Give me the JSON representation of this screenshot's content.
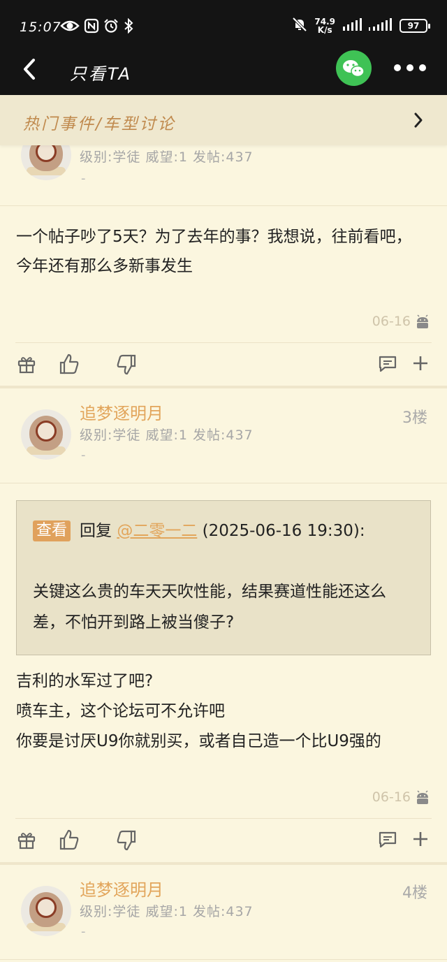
{
  "status": {
    "time": "15:07",
    "speed_value": "74.9",
    "speed_unit": "K/s",
    "battery": "97"
  },
  "nav": {
    "title": "只看TA"
  },
  "category": {
    "label": "热门事件/车型讨论"
  },
  "posts": [
    {
      "level_text": "级别:学徒 威望:1 发帖:437",
      "dash": "-",
      "content": "一个帖子吵了5天？为了去年的事？我想说，往前看吧，今年还有那么多新事发生",
      "date": "06-16"
    },
    {
      "username": "追梦逐明月",
      "floor": "3楼",
      "level_text": "级别:学徒 威望:1 发帖:437",
      "dash": "-",
      "quote": {
        "tag": "查看",
        "reply_prefix": "回复 ",
        "mention": "@二零一二",
        "reply_time": " (2025-06-16 19:30):",
        "text": "关键这么贵的车天天吹性能，结果赛道性能还这么差，不怕开到路上被当傻子?"
      },
      "lines": [
        "吉利的水军过了吧?",
        "喷车主，这个论坛可不允许吧",
        "你要是讨厌U9你就别买，或者自己造一个比U9强的"
      ],
      "date": "06-16"
    },
    {
      "username": "追梦逐明月",
      "floor": "4楼",
      "level_text": "级别:学徒 威望:1 发帖:437",
      "dash": "-"
    }
  ]
}
